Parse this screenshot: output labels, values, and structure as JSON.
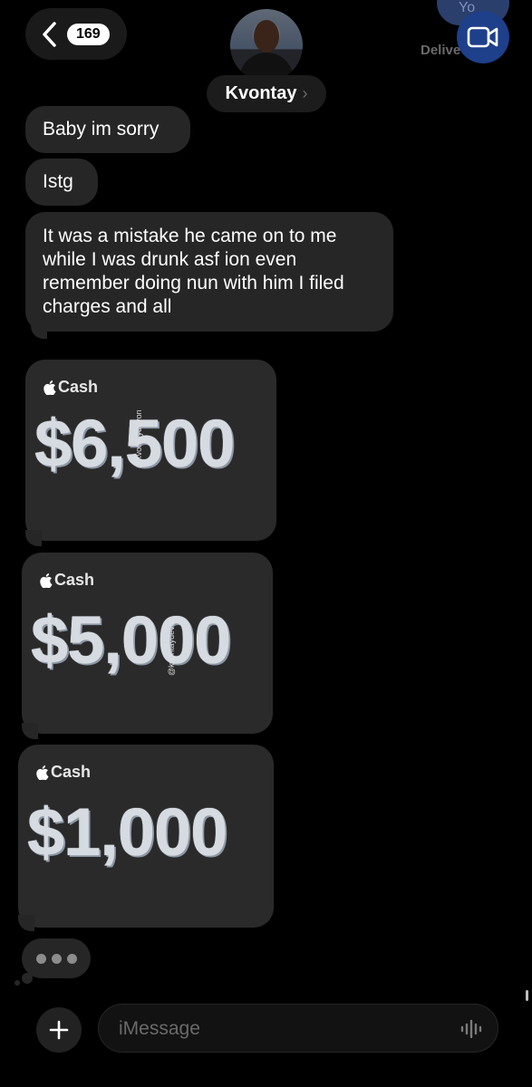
{
  "header": {
    "back_badge": "169",
    "contact_name": "Kvontay",
    "name_chevron": "›",
    "ghost_top_text": "Yo",
    "delivered_text": "Delive"
  },
  "messages": [
    {
      "text": "Baby im sorry"
    },
    {
      "text": "Istg"
    },
    {
      "text": "It was a mistake he came on to me while I was drunk asf ion even remember doing nun with him I filed charges and all"
    }
  ],
  "cash_payments": [
    {
      "label": "Cash",
      "amount": "$6,500",
      "watermark": "@kvontaydevon"
    },
    {
      "label": "Cash",
      "amount": "$5,000",
      "watermark": "@kvontaydevon"
    },
    {
      "label": "Cash",
      "amount": "$1,000"
    }
  ],
  "composer": {
    "placeholder": "iMessage"
  },
  "icons": {
    "back": "chevron-left-icon",
    "video": "video-camera-icon",
    "apple": "apple-logo-icon",
    "plus": "plus-icon",
    "mic": "audio-waveform-icon"
  },
  "colors": {
    "background": "#000000",
    "bubble": "#262626",
    "video_button": "#1e3f8a"
  }
}
